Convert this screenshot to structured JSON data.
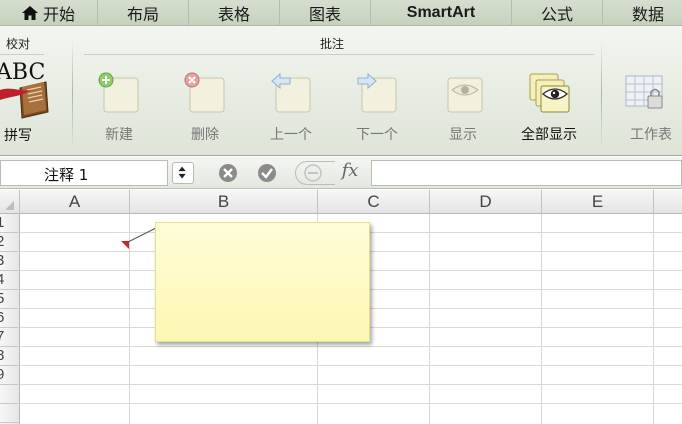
{
  "ribbon_tabs": [
    {
      "label": "开始"
    },
    {
      "label": "布局"
    },
    {
      "label": "表格"
    },
    {
      "label": "图表"
    },
    {
      "label": "SmartArt"
    },
    {
      "label": "公式"
    },
    {
      "label": "数据"
    }
  ],
  "groups": {
    "proofing": {
      "title": "校对",
      "spelling_label": "拼写",
      "icon_text": "ABC"
    },
    "comments": {
      "title": "批注"
    }
  },
  "buttons": {
    "new": "新建",
    "delete": "删除",
    "previous": "上一个",
    "next": "下一个",
    "show": "显示",
    "show_all": "全部显示",
    "worksheet": "工作表"
  },
  "formula_bar": {
    "name_box": "注释 1",
    "fx": "fx",
    "value": ""
  },
  "columns": [
    "A",
    "B",
    "C",
    "D",
    "E"
  ],
  "rows": [
    "1",
    "2",
    "3",
    "4",
    "5",
    "6",
    "7",
    "8",
    "9"
  ],
  "colors": {
    "ribbon_tab_bg": "#c5d1bd",
    "comment_fill": "#fdf7b3",
    "comment_marker": "#d0222a"
  }
}
